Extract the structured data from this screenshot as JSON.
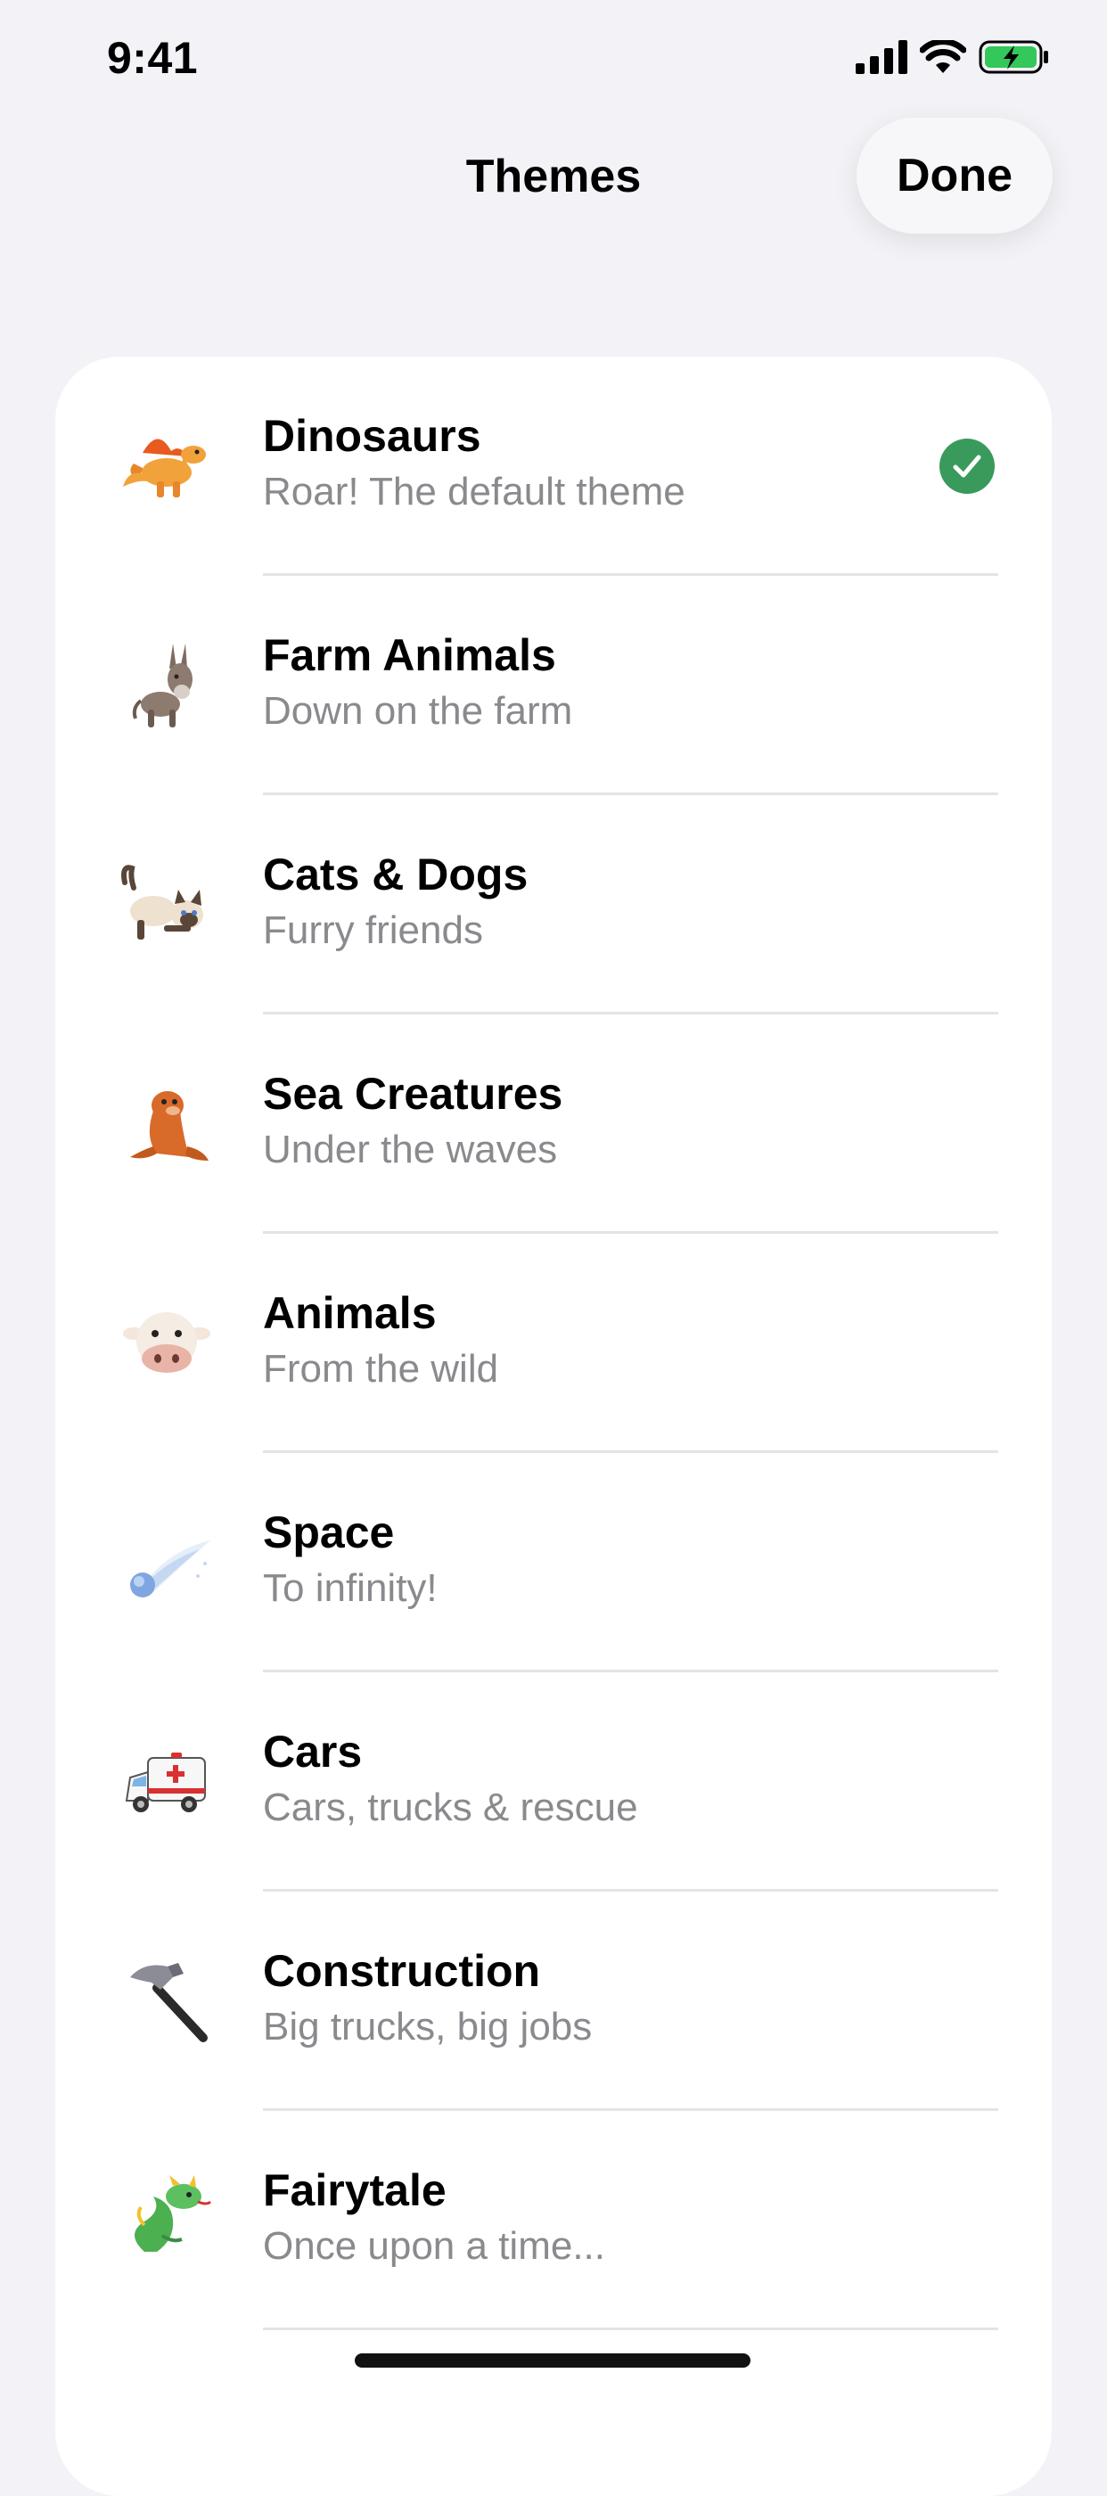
{
  "status_bar": {
    "time": "9:41",
    "icons": [
      "signal-icon",
      "wifi-icon",
      "battery-charging-icon"
    ]
  },
  "nav": {
    "title": "Themes",
    "done_label": "Done"
  },
  "colors": {
    "accent_check": "#3a9a5c",
    "background": "#f2f2f7",
    "subtitle": "#8a8a8e"
  },
  "themes": [
    {
      "title": "Dinosaurs",
      "subtitle": "Roar! The default theme",
      "icon": "dinosaur-icon",
      "selected": true
    },
    {
      "title": "Farm Animals",
      "subtitle": "Down on the farm",
      "icon": "donkey-icon",
      "selected": false
    },
    {
      "title": "Cats & Dogs",
      "subtitle": "Furry friends",
      "icon": "cat-icon",
      "selected": false
    },
    {
      "title": "Sea Creatures",
      "subtitle": "Under the waves",
      "icon": "seal-icon",
      "selected": false
    },
    {
      "title": "Animals",
      "subtitle": "From the wild",
      "icon": "cow-icon",
      "selected": false
    },
    {
      "title": "Space",
      "subtitle": "To infinity!",
      "icon": "comet-icon",
      "selected": false
    },
    {
      "title": "Cars",
      "subtitle": "Cars, trucks & rescue",
      "icon": "ambulance-icon",
      "selected": false
    },
    {
      "title": "Construction",
      "subtitle": "Big trucks, big jobs",
      "icon": "hammer-icon",
      "selected": false
    },
    {
      "title": "Fairytale",
      "subtitle": "Once upon a time...",
      "icon": "dragon-icon",
      "selected": false
    }
  ]
}
